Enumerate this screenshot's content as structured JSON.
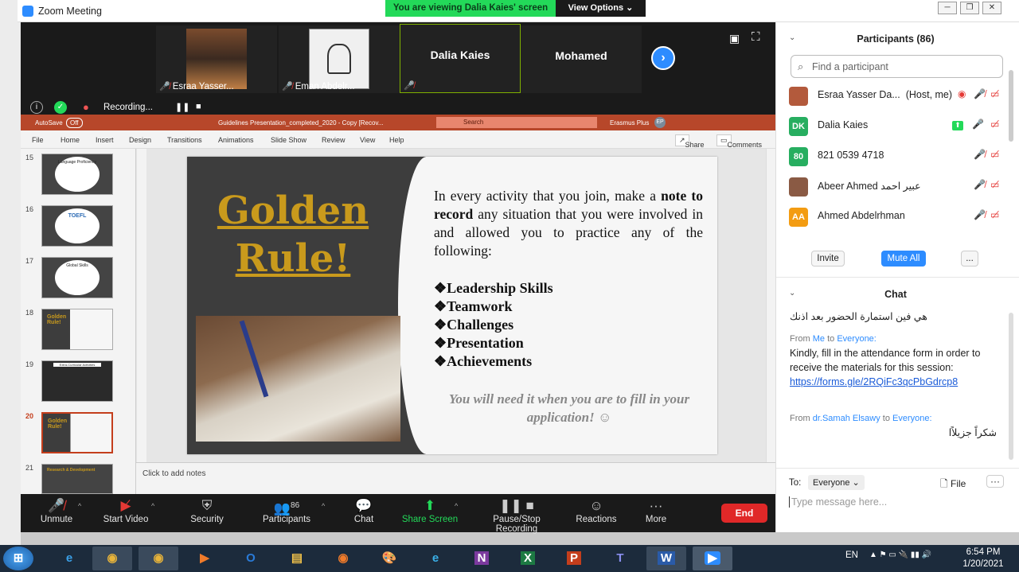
{
  "window": {
    "title": "Zoom Meeting",
    "minimize": "─",
    "restore": "❐",
    "close": "✕"
  },
  "banner": {
    "viewing": "You are viewing Dalia Kaies' screen",
    "view_options": "View Options ⌄"
  },
  "video": {
    "tiles": [
      {
        "name": "Esraa Yasser..."
      },
      {
        "name": "Eman Abdelr..."
      },
      {
        "name": "Dalia Kaies"
      },
      {
        "name": "Mohamed"
      }
    ],
    "recording": "Recording..."
  },
  "ppt": {
    "autosave": "AutoSave",
    "autosave_state": "Off",
    "doc_title": "Guidelines Presentation_completed_2020 - Copy [Recov...",
    "search": "Search",
    "account": "Erasmus Plus",
    "account_initials": "EP",
    "menu": [
      "File",
      "Home",
      "Insert",
      "Design",
      "Transitions",
      "Animations",
      "Slide Show",
      "Review",
      "View",
      "Help"
    ],
    "share": "Share",
    "comments": "Comments",
    "thumbs": [
      {
        "num": "15",
        "label": "Language Proficiency"
      },
      {
        "num": "16",
        "label": "TOEFL"
      },
      {
        "num": "17",
        "label": "Global Skills"
      },
      {
        "num": "18",
        "label": "Golden Rule!"
      },
      {
        "num": "19",
        "label": "Extra-Curricular Activities"
      },
      {
        "num": "20",
        "label": "Golden Rule!"
      },
      {
        "num": "21",
        "label": "Research & Development"
      }
    ],
    "notes": "Click to add notes"
  },
  "slide": {
    "heading_line1": "Golden",
    "heading_line2": "Rule!",
    "text_a": "In every activity that you join, make a ",
    "text_b": "note to record",
    "text_c": " any situation that you were involved in and allowed you to practice any of the following:",
    "list": [
      "❖Leadership Skills",
      "❖Teamwork",
      "❖Challenges",
      "❖Presentation",
      "❖Achievements"
    ],
    "note": "You will need it when you are to fill in your application! ☺"
  },
  "toolbar": {
    "unmute": "Unmute",
    "start_video": "Start Video",
    "security": "Security",
    "participants": "Participants",
    "participants_count": "86",
    "chat": "Chat",
    "share_screen": "Share Screen",
    "recording": "Pause/Stop Recording",
    "reactions": "Reactions",
    "more": "More",
    "end": "End"
  },
  "participants": {
    "title": "Participants (86)",
    "search_placeholder": "Find a participant",
    "list": [
      {
        "initials": "",
        "name": "Esraa Yasser Da...",
        "role": "(Host, me)",
        "color": "#b35a3c"
      },
      {
        "initials": "DK",
        "name": "Dalia Kaies",
        "role": "",
        "color": "#27ae60"
      },
      {
        "initials": "80",
        "name": "821 0539 4718",
        "role": "",
        "color": "#27ae60"
      },
      {
        "initials": "",
        "name": "Abeer Ahmed عبير احمد",
        "role": "",
        "color": "#8a5a44"
      },
      {
        "initials": "AA",
        "name": "Ahmed Abdelrhman",
        "role": "",
        "color": "#f39c12"
      }
    ],
    "invite": "Invite",
    "mute_all": "Mute All",
    "more": "..."
  },
  "chat": {
    "title": "Chat",
    "msg0": "هي فين استمارة الحضور بعد اذنك",
    "from_label": "From",
    "to_label": "to",
    "msg1_from": "Me",
    "msg1_to": "Everyone:",
    "msg1": "Kindly, fill in the attendance form in order to receive the materials for this session:",
    "msg1_link": "https://forms.gle/2RQiFc3qcPbGdrcp8",
    "msg2_from": "dr.Samah Elsawy",
    "msg2_to": "Everyone:",
    "msg2": "شكراً جزيلاًا",
    "to": "To:",
    "recipient": "Everyone ⌄",
    "file": "File",
    "more": "···",
    "input_placeholder": "Type message here..."
  },
  "taskbar": {
    "lang": "EN",
    "time": "6:54 PM",
    "date": "1/20/2021",
    "apps": [
      "Start",
      "Internet Explorer",
      "Chrome",
      "Chrome",
      "Media",
      "Outlook",
      "Explorer",
      "Firefox",
      "Paint",
      "Edge",
      "OneNote",
      "Excel",
      "PowerPoint",
      "Teams",
      "Word",
      "Zoom"
    ]
  }
}
